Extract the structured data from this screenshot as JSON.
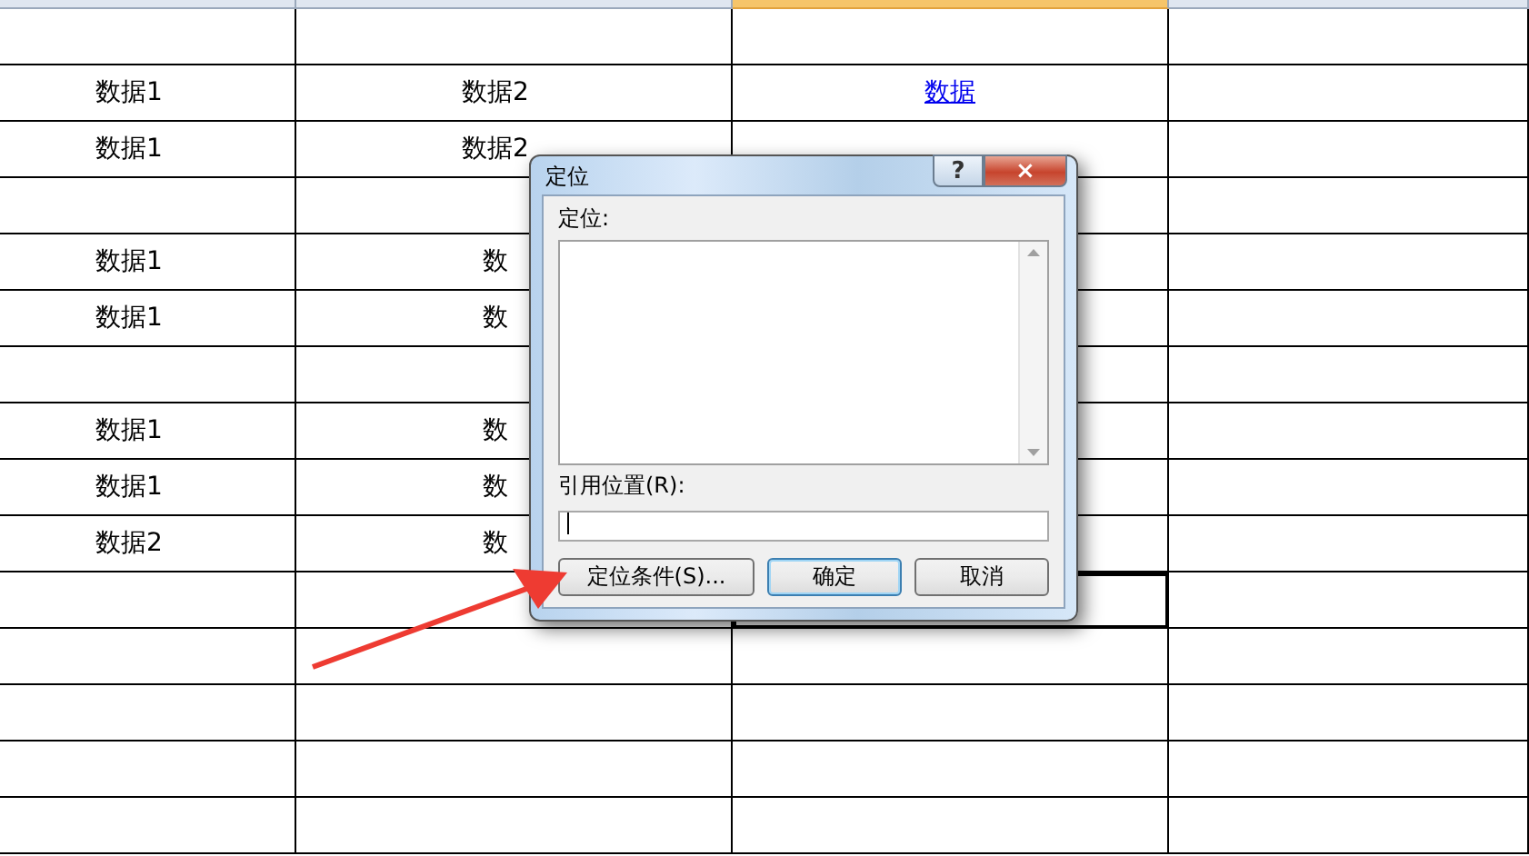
{
  "column_headers": [
    {
      "selected": false
    },
    {
      "selected": false
    },
    {
      "selected": true
    },
    {
      "selected": false
    }
  ],
  "rows": [
    {
      "cells": [
        {
          "selected": false
        },
        {
          "selected": false
        },
        {
          "selected": false
        },
        {
          "selected": false
        }
      ]
    },
    {
      "cells": [
        {
          "text": "数据1",
          "kind": "text",
          "selected": false
        },
        {
          "text": "数据2",
          "kind": "text",
          "selected": false
        },
        {
          "text": "数据",
          "kind": "link",
          "selected": false
        },
        {
          "selected": false
        }
      ]
    },
    {
      "cells": [
        {
          "text": "数据1",
          "kind": "text",
          "selected": false
        },
        {
          "text": "数据2",
          "kind": "text",
          "selected": false
        },
        {
          "selected": false
        },
        {
          "selected": false
        }
      ]
    },
    {
      "cells": [
        {
          "selected": false
        },
        {
          "selected": false
        },
        {
          "selected": false
        },
        {
          "selected": false
        }
      ]
    },
    {
      "cells": [
        {
          "text": "数据1",
          "kind": "text",
          "selected": false
        },
        {
          "text": "数",
          "kind": "text",
          "selected": false
        },
        {
          "selected": false
        },
        {
          "selected": false
        }
      ]
    },
    {
      "cells": [
        {
          "text": "数据1",
          "kind": "text",
          "selected": false
        },
        {
          "text": "数",
          "kind": "text",
          "selected": false
        },
        {
          "selected": false
        },
        {
          "selected": false
        }
      ]
    },
    {
      "cells": [
        {
          "selected": false
        },
        {
          "selected": false
        },
        {
          "selected": false
        },
        {
          "selected": false
        }
      ]
    },
    {
      "cells": [
        {
          "text": "数据1",
          "kind": "text",
          "selected": false
        },
        {
          "text": "数",
          "kind": "text",
          "selected": false
        },
        {
          "selected": false
        },
        {
          "selected": false
        }
      ]
    },
    {
      "cells": [
        {
          "text": "数据1",
          "kind": "text",
          "selected": false
        },
        {
          "text": "数",
          "kind": "text",
          "selected": false
        },
        {
          "selected": false
        },
        {
          "selected": false
        }
      ]
    },
    {
      "cells": [
        {
          "text": "数据2",
          "kind": "text",
          "selected": false
        },
        {
          "text": "数",
          "kind": "text",
          "selected": false
        },
        {
          "selected": false
        },
        {
          "selected": false
        }
      ]
    },
    {
      "cells": [
        {
          "selected": false
        },
        {
          "selected": false
        },
        {
          "selected": true
        },
        {
          "selected": false
        }
      ]
    },
    {
      "cells": [
        {
          "selected": false
        },
        {
          "selected": false
        },
        {
          "selected": false
        },
        {
          "selected": false
        }
      ]
    },
    {
      "cells": [
        {
          "selected": false
        },
        {
          "selected": false
        },
        {
          "selected": false
        },
        {
          "selected": false
        }
      ]
    },
    {
      "cells": [
        {
          "selected": false
        },
        {
          "selected": false
        },
        {
          "selected": false
        },
        {
          "selected": false
        }
      ]
    },
    {
      "cells": [
        {
          "selected": false
        },
        {
          "selected": false
        },
        {
          "selected": false
        },
        {
          "selected": false
        }
      ]
    }
  ],
  "dialog": {
    "title": "定位",
    "help": "?",
    "close": "×",
    "list_label": "定位:",
    "reference_label": "引用位置(R):",
    "buttons": [
      {
        "label": "定位条件(S)...",
        "default": false
      },
      {
        "label": "确定",
        "default": true
      },
      {
        "label": "取消",
        "default": false
      }
    ]
  }
}
